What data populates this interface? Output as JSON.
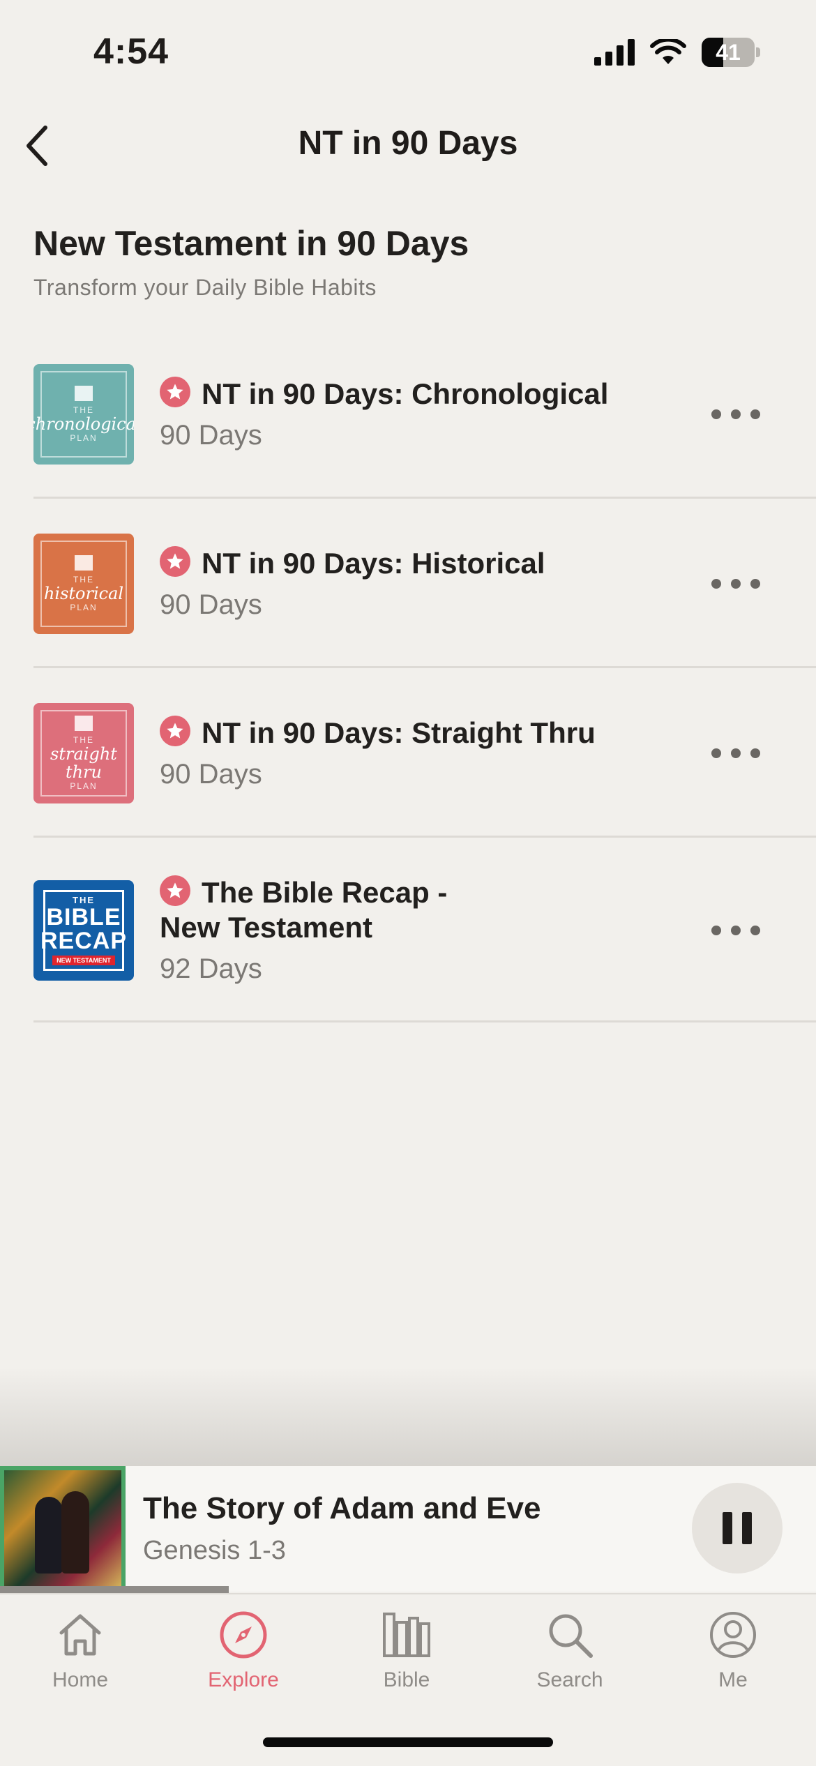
{
  "status_bar": {
    "time": "4:54",
    "battery": "41",
    "battery_level": 0.41,
    "icons": [
      "signal-icon",
      "wifi-icon",
      "battery-icon"
    ]
  },
  "nav": {
    "title": "NT in 90 Days",
    "back_icon": "chevron-left-icon"
  },
  "header": {
    "title": "New Testament in 90 Days",
    "subtitle": "Transform your Daily Bible Habits"
  },
  "plans": [
    {
      "title": "NT in 90 Days: Chronological",
      "duration": "90 Days",
      "thumb_text": "chronological",
      "thumb_color": "#6fb1ae"
    },
    {
      "title": "NT in 90 Days: Historical",
      "duration": "90 Days",
      "thumb_text": "historical",
      "thumb_color": "#d97347"
    },
    {
      "title": "NT in 90 Days: Straight Thru",
      "duration": "90 Days",
      "thumb_text": "straight thru",
      "thumb_color": "#dd6f7b"
    },
    {
      "title_line1": "The Bible Recap -",
      "title_line2": "New Testament",
      "duration": "92 Days",
      "thumb_the": "THE",
      "thumb_main1": "BIBLE",
      "thumb_main2": "RECAP",
      "thumb_nt": "NEW TESTAMENT",
      "thumb_color": "#135ea6"
    }
  ],
  "now_playing": {
    "title": "The Story of Adam and Eve",
    "subtitle": "Genesis 1-3",
    "progress": 0.28
  },
  "tabs": [
    {
      "label": "Home",
      "icon": "home-icon",
      "active": false
    },
    {
      "label": "Explore",
      "icon": "compass-icon",
      "active": true
    },
    {
      "label": "Bible",
      "icon": "books-icon",
      "active": false
    },
    {
      "label": "Search",
      "icon": "search-icon",
      "active": false
    },
    {
      "label": "Me",
      "icon": "profile-icon",
      "active": false
    }
  ],
  "colors": {
    "accent": "#e26472",
    "background": "#f2f0ec",
    "muted_text": "#7b7874"
  }
}
